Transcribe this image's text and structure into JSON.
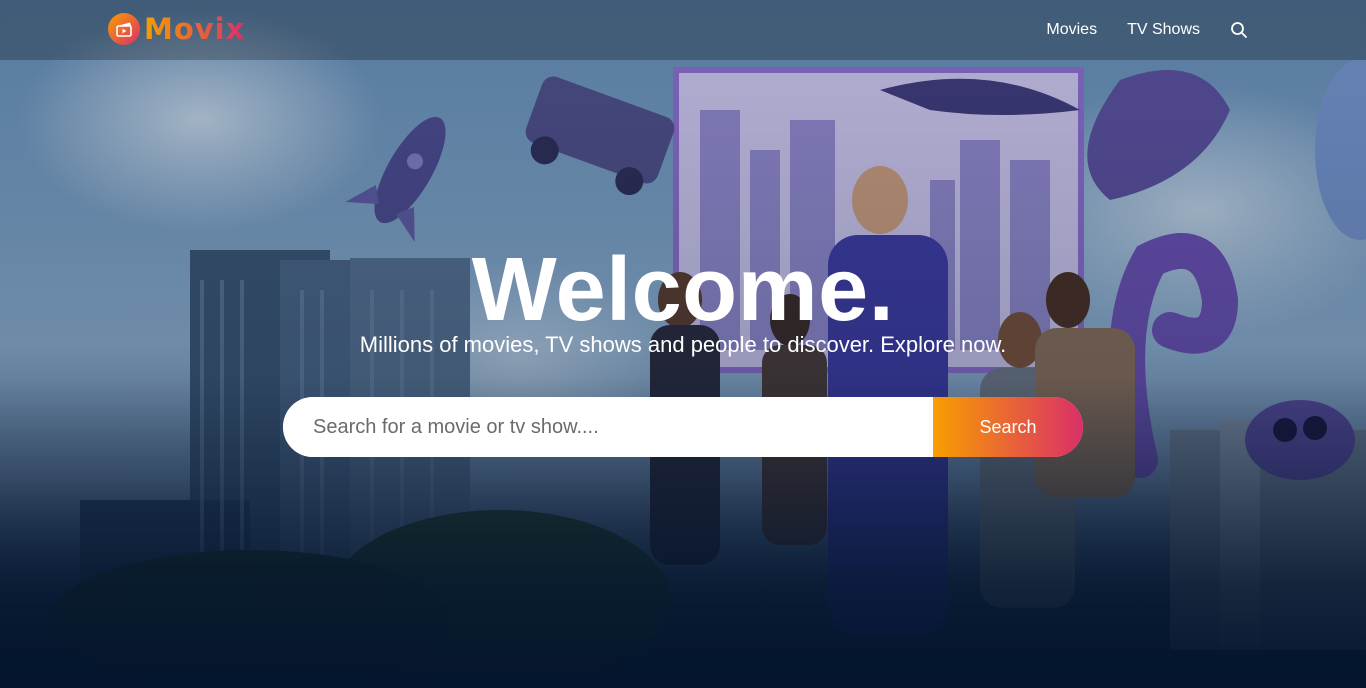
{
  "brand": {
    "name": "Movix",
    "logo_icon": "clapperboard-icon",
    "accent_start": "#f89e00",
    "accent_end": "#da2f68"
  },
  "nav": {
    "items": [
      {
        "label": "Movies"
      },
      {
        "label": "TV Shows"
      }
    ],
    "search_icon": "search-icon"
  },
  "hero": {
    "title": "Welcome.",
    "subtitle": "Millions of movies, TV shows and people to discover. Explore now.",
    "search_placeholder": "Search for a movie or tv show....",
    "search_button": "Search"
  },
  "colors": {
    "background": "#04152d",
    "text": "#ffffff"
  }
}
